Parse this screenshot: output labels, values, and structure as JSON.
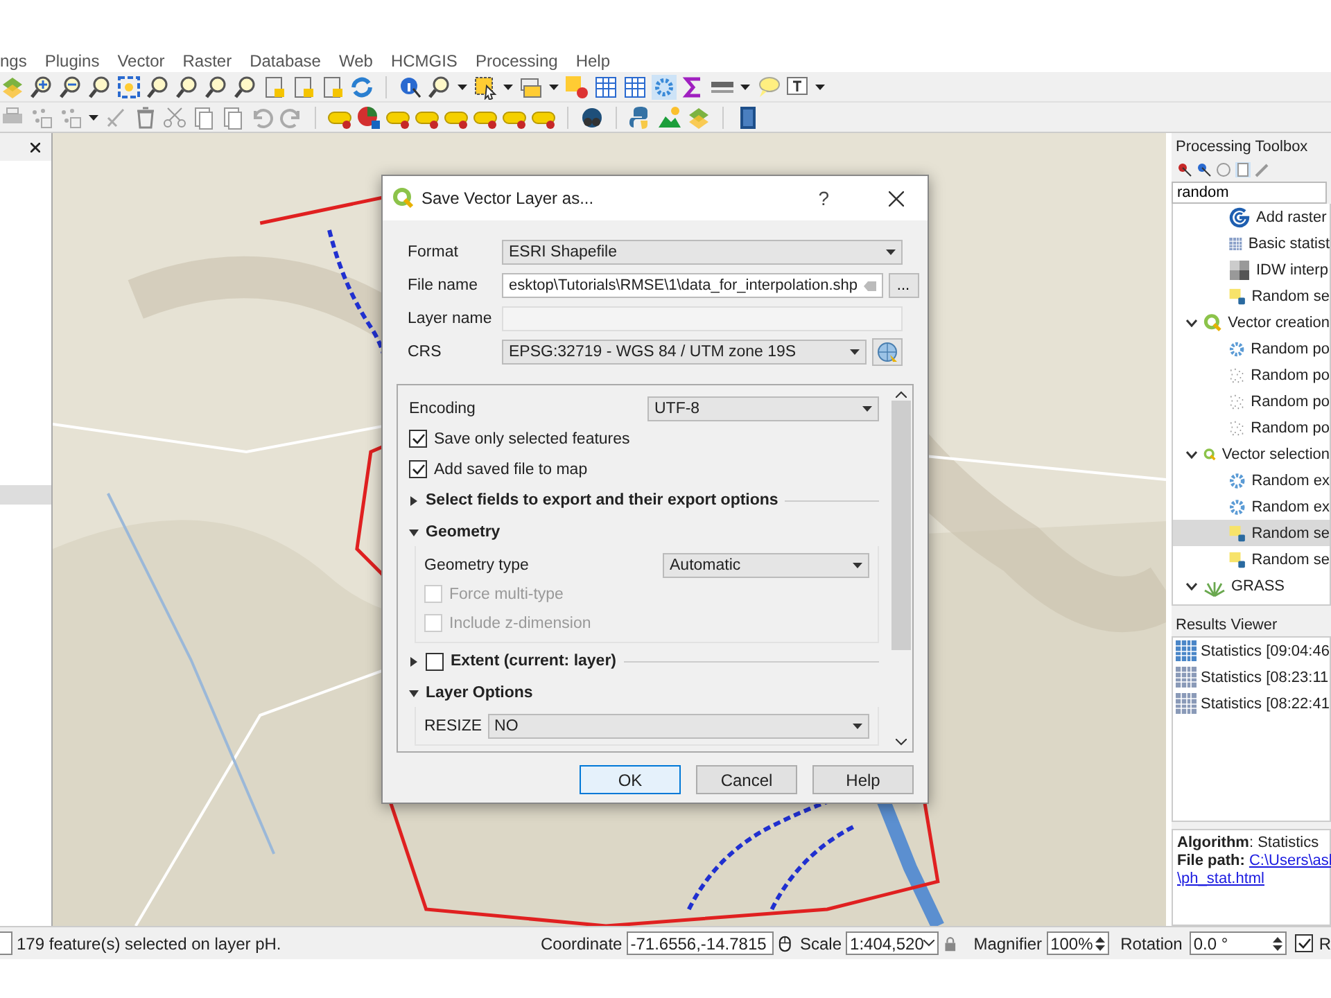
{
  "menu_bar": [
    "ngs",
    "Plugins",
    "Vector",
    "Raster",
    "Database",
    "Web",
    "HCMGIS",
    "Processing",
    "Help"
  ],
  "dialog": {
    "title": "Save Vector Layer as...",
    "help": "?",
    "fields": [
      {
        "kind": "combo",
        "label": "Format",
        "value": "ESRI Shapefile"
      },
      {
        "kind": "file",
        "label": "File name",
        "value": "esktop\\Tutorials\\RMSE\\1\\data_for_interpolation.shp",
        "browse": "..."
      },
      {
        "kind": "text",
        "label": "Layer name",
        "disabled": true
      },
      {
        "kind": "crs",
        "label": "CRS",
        "value": "EPSG:32719 - WGS 84 / UTM zone 19S"
      }
    ],
    "options": [
      {
        "kind": "combo",
        "label": "Encoding",
        "value": "UTF-8"
      },
      {
        "kind": "checkbox",
        "label": "Save only selected features",
        "checked": true,
        "disabled": false
      },
      {
        "kind": "checkbox",
        "label": "Add saved file to map",
        "checked": true,
        "disabled": false
      },
      {
        "kind": "section",
        "label": "Select fields to export and their export options",
        "expanded": false
      },
      {
        "kind": "section",
        "label": "Geometry",
        "expanded": true,
        "children": [
          {
            "kind": "combo",
            "label": "Geometry type",
            "value": "Automatic"
          },
          {
            "kind": "checkbox",
            "label": "Force multi-type",
            "checked": false,
            "disabled": true
          },
          {
            "kind": "checkbox",
            "label": "Include z-dimension",
            "checked": false,
            "disabled": true
          }
        ]
      },
      {
        "kind": "checkable_section",
        "label": "Extent (current: layer)",
        "expanded": false,
        "checked": false
      },
      {
        "kind": "section",
        "label": "Layer Options",
        "expanded": true,
        "children": [
          {
            "kind": "inline_combo",
            "label": "RESIZE",
            "value": "NO"
          }
        ]
      }
    ],
    "buttons": [
      {
        "label": "OK",
        "selected": true
      },
      {
        "label": "Cancel",
        "selected": false
      },
      {
        "label": "Help",
        "selected": false
      }
    ]
  },
  "toolbox": {
    "title": "Processing Toolbox",
    "search": {
      "value": "random"
    },
    "items": [
      {
        "kind": "swirl",
        "label": "Add raster",
        "selected": false
      },
      {
        "kind": "grid",
        "label": "Basic statist",
        "selected": false
      },
      {
        "kind": "raster",
        "label": "IDW interp",
        "selected": false
      },
      {
        "kind": "selection",
        "label": "Random se",
        "selected": false
      },
      {
        "kind": "provider",
        "label": "Vector creation",
        "expanded": true,
        "selected": false,
        "children": [
          {
            "kind": "gear",
            "label": "Random po",
            "selected": false
          },
          {
            "kind": "points",
            "label": "Random po",
            "selected": false
          },
          {
            "kind": "points",
            "label": "Random po",
            "selected": false
          },
          {
            "kind": "points",
            "label": "Random po",
            "selected": false
          }
        ]
      },
      {
        "kind": "provider",
        "label": "Vector selection",
        "expanded": true,
        "selected": false,
        "children": [
          {
            "kind": "gear",
            "label": "Random ex",
            "selected": false
          },
          {
            "kind": "gear",
            "label": "Random ex",
            "selected": false
          },
          {
            "kind": "selection",
            "label": "Random se",
            "selected": true
          },
          {
            "kind": "selection",
            "label": "Random se",
            "selected": false
          }
        ]
      },
      {
        "kind": "grass",
        "label": "GRASS",
        "expanded": true,
        "selected": false
      }
    ]
  },
  "results_viewer": {
    "title": "Results Viewer",
    "items": [
      {
        "label": "Statistics [09:04:46",
        "selected": true
      },
      {
        "label": "Statistics [08:23:11",
        "selected": false
      },
      {
        "label": "Statistics [08:22:41",
        "selected": false
      }
    ],
    "info": {
      "algorithm": "**Algorithm**: Statistics",
      "file_path_label": "File path:",
      "link_lines": [
        "C:\\Users\\asl",
        "\\ph_stat.html"
      ]
    }
  },
  "status_bar": {
    "message": "179 feature(s) selected on layer pH.",
    "coordinate_label": "Coordinate",
    "coordinate": "-71.6556,-14.7815",
    "scale_label": "Scale",
    "scale": "1:404,520",
    "magnifier_label": "Magnifier",
    "magnifier": "100%",
    "rotation_label": "Rotation",
    "rotation": "0.0 °",
    "render": {
      "label": "R",
      "checked": true
    }
  }
}
